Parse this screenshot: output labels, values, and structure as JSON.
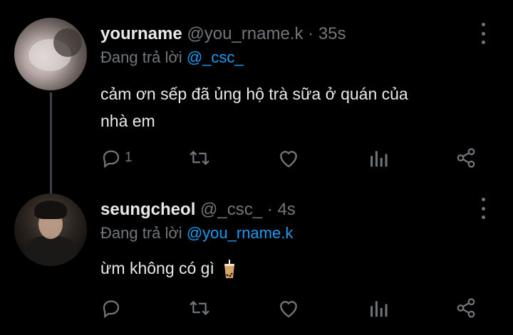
{
  "tweets": [
    {
      "name": "yourname",
      "handle": "@you_rname.k",
      "separator": "·",
      "time": "35s",
      "replying_prefix": "Đang trả lời",
      "replying_to": "@_csc_",
      "text_line1": "cảm ơn sếp đã ủng hộ trà sữa ở quán của",
      "text_line2": "nhà em",
      "reply_count": "1"
    },
    {
      "name": "seungcheol",
      "handle": "@_csc_",
      "separator": "·",
      "time": "4s",
      "replying_prefix": "Đang trả lời",
      "replying_to": "@you_rname.k",
      "text_line1": "ừm không có gì",
      "reply_count": ""
    }
  ],
  "icons": {
    "reply": "reply-icon",
    "retweet": "retweet-icon",
    "like": "heart-icon",
    "views": "views-icon",
    "share": "share-icon",
    "more": "more-vertical-icon",
    "emoji": "bubble-tea-emoji"
  },
  "colors": {
    "background": "#000000",
    "text": "#e7e9ea",
    "muted": "#71767b",
    "link": "#1d9bf0",
    "thread_line": "#3d4146"
  }
}
